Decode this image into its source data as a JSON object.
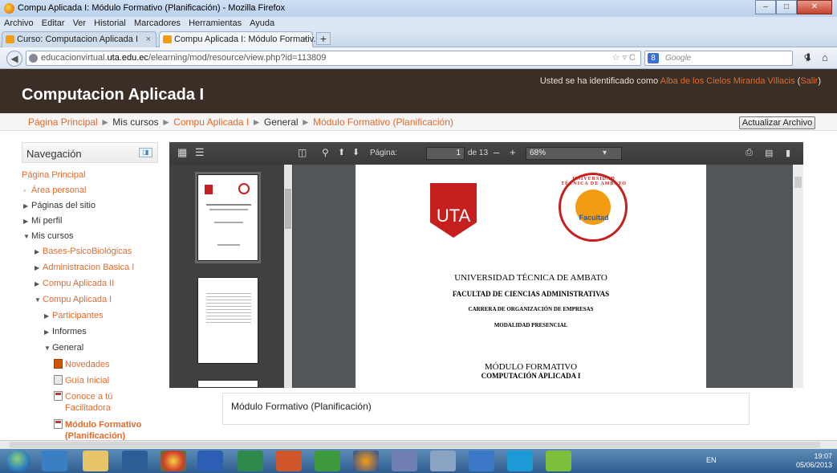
{
  "window": {
    "title": "Compu Aplicada I: Módulo Formativo (Planificación) - Mozilla Firefox"
  },
  "menu": [
    "Archivo",
    "Editar",
    "Ver",
    "Historial",
    "Marcadores",
    "Herramientas",
    "Ayuda"
  ],
  "tabs": [
    {
      "label": "Curso: Computacion Aplicada I"
    },
    {
      "label": "Compu Aplicada I: Módulo Formativ..."
    }
  ],
  "url": {
    "host": "educacionvirtual.",
    "domain": "uta.edu.ec",
    "path": "/elearning/mod/resource/view.php?id=113809"
  },
  "search": {
    "placeholder": "Google"
  },
  "header": {
    "site_name": "Computacion Aplicada I",
    "login_prefix": "Usted se ha identificado como",
    "user": "Alba de los Cielos Miranda Villacis",
    "logout": "Salir"
  },
  "breadcrumb": {
    "home": "Página Principal",
    "courses": "Mis cursos",
    "course": "Compu Aplicada I",
    "section": "General",
    "current": "Módulo Formativo (Planificación)",
    "sep": "►"
  },
  "update_button": "Actualizar Archivo",
  "nav": {
    "title": "Navegación",
    "items": {
      "home": "Página Principal",
      "personal": "Área personal",
      "site_pages": "Páginas del sitio",
      "profile": "Mi perfil",
      "my_courses": "Mis cursos",
      "c1": "Bases-PsicoBiológicas",
      "c2": "Administracion Basica I",
      "c3": "Compu Aplicada II",
      "c4": "Compu Aplicada I",
      "participants": "Participantes",
      "reports": "Informes",
      "general": "General",
      "news": "Novedades",
      "guide": "Guía Inicial",
      "tutor1": "Conoce a tú",
      "tutor2": "Facilitadora",
      "module1": "Módulo Formativo",
      "module2": "(Planificación)"
    }
  },
  "pdf": {
    "page_label": "Página:",
    "page": "1",
    "of": "de 13",
    "zoom": "68%",
    "logo_text": "UTA",
    "seal_inner": "Facultad",
    "seal_ring": "UNIVERSIDAD TÉCNICA DE AMBATO",
    "lines": [
      "UNIVERSIDAD TÉCNICA DE AMBATO",
      "FACULTAD DE CIENCIAS ADMINISTRATIVAS",
      "CARRERA DE ORGANIZACIÓN DE EMPRESAS",
      "MODALIDAD PRESENCIAL",
      "MÓDULO FORMATIVO",
      "COMPUTACIÓN APLICADA I"
    ]
  },
  "resource_name": "Módulo Formativo (Planificación)",
  "tray": {
    "lang": "EN",
    "time": "19:07",
    "date": "05/06/2013"
  }
}
